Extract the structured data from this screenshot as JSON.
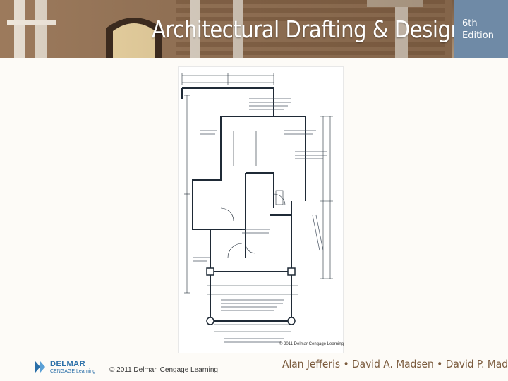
{
  "header": {
    "title": "Architectural Drafting & Design",
    "edition_number": "6th",
    "edition_word": "Edition"
  },
  "figure": {
    "copyright": "© 2011 Delmar Cengage Learning"
  },
  "footer": {
    "logo_top": "DELMAR",
    "logo_bottom": "CENGAGE Learning",
    "copyright": "© 2011 Delmar, Cengage Learning",
    "authors": "Alan Jefferis • David A. Madsen • David P. Madsen"
  },
  "colors": {
    "banner_brown": "#b99a7c",
    "edition_blue": "#6f8aa6",
    "plan_line": "#1f2a36",
    "author_text": "#7a5a3c",
    "logo_blue": "#2a6fa8"
  }
}
